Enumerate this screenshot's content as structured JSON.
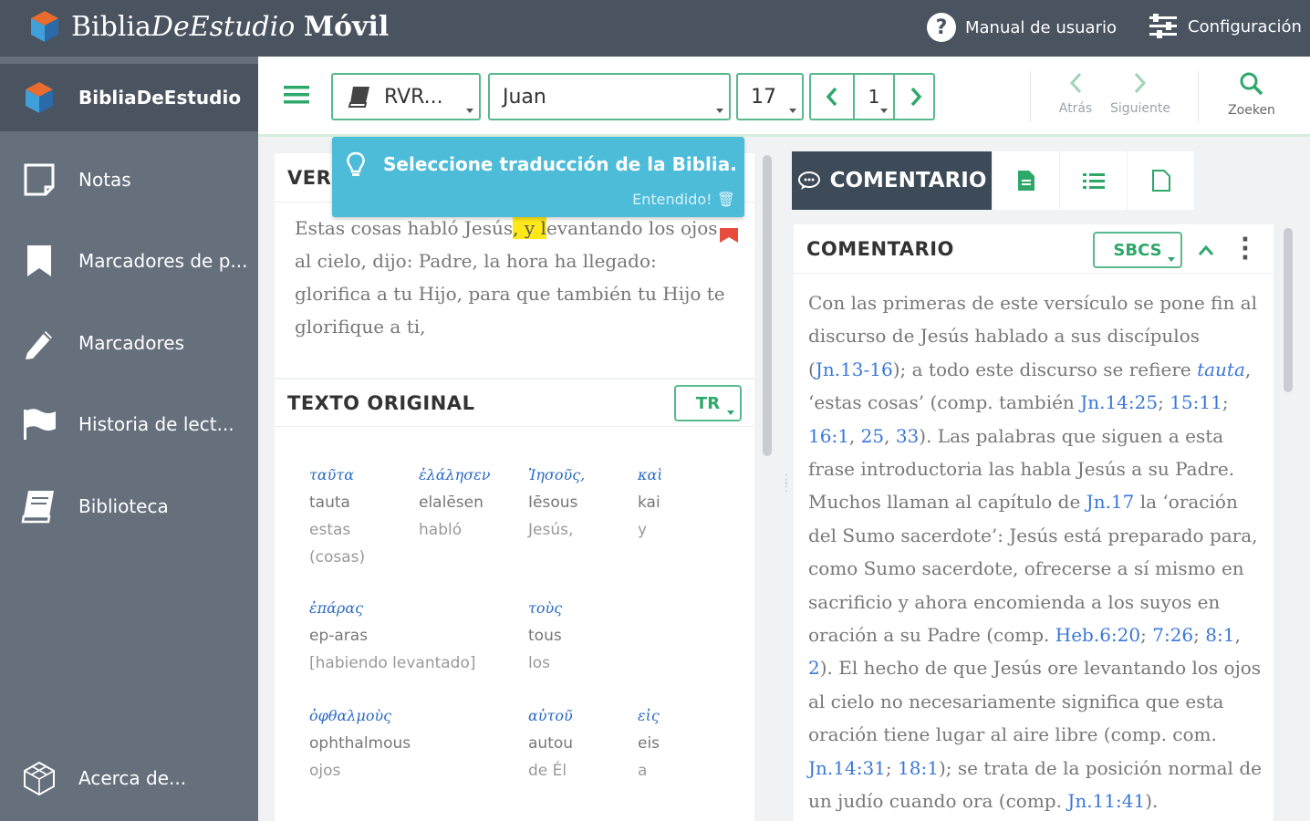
{
  "app": {
    "brand_a": "Biblia",
    "brand_b": "DeEstudio",
    "brand_c": "Móvil"
  },
  "header": {
    "help_label": "Manual de usuario",
    "settings_label": "Configuración"
  },
  "sidebar": {
    "items": [
      {
        "label": "BibliaDeEstudio",
        "icon": "cube-logo-icon",
        "active": true
      },
      {
        "label": "Notas",
        "icon": "note-icon"
      },
      {
        "label": "Marcadores de p...",
        "icon": "bookmark-icon"
      },
      {
        "label": "Marcadores",
        "icon": "pencil-icon"
      },
      {
        "label": "Historia de lect...",
        "icon": "flag-icon"
      },
      {
        "label": "Biblioteca",
        "icon": "books-icon"
      },
      {
        "label": "Acerca de...",
        "icon": "cube-outline-icon"
      }
    ]
  },
  "toolbar": {
    "translation": "RVR...",
    "book": "Juan",
    "chapter": "17",
    "verse": "1",
    "back_label": "Atrás",
    "next_label": "Siguiente",
    "search_label": "Zoeken"
  },
  "tooltip": {
    "message": "Seleccione traducción de la Biblia.",
    "dismiss": "Entendido!"
  },
  "verse_panel": {
    "title": "VER",
    "text_before": "Estas cosas habló Jesús",
    "text_highlight": ", y l",
    "text_after": "evantando los ojos al cielo, dijo: Padre, la hora ha llegado: glorifica a tu Hijo, para que también tu Hijo te glorifique a ti,"
  },
  "original_panel": {
    "title": "TEXTO ORIGINAL",
    "version": "TR",
    "words": [
      {
        "greek": "ταῦτα",
        "translit": "tauta",
        "spanish": "estas (cosas)"
      },
      {
        "greek": "ἐλάλησεν",
        "translit": "elalēsen",
        "spanish": "habló"
      },
      {
        "greek": "Ἰησοῦς,",
        "translit": "Iēsous",
        "spanish": "Jesús,"
      },
      {
        "greek": "καὶ",
        "translit": "kai",
        "spanish": "y"
      },
      {
        "greek": "ἐπάρας",
        "translit": "ep-aras",
        "spanish": "[habiendo levantado]"
      },
      {
        "greek": "τοὺς",
        "translit": "tous",
        "spanish": "los"
      },
      {
        "greek": "ὀφθαλμοὺς",
        "translit": "ophthalmous",
        "spanish": "ojos"
      },
      {
        "greek": "αὐτοῦ",
        "translit": "autou",
        "spanish": "de Él"
      },
      {
        "greek": "εἰς",
        "translit": "eis",
        "spanish": "a"
      }
    ]
  },
  "commentary": {
    "tab_label": "COMENTARIO",
    "title": "COMENTARIO",
    "source": "SBCS",
    "segments": [
      {
        "t": "Con las primeras de este versículo se pone fin al discurso de Jesús hablado a sus discípulos ("
      },
      {
        "t": "Jn.13-16",
        "link": true
      },
      {
        "t": "); a todo este discurso se refiere "
      },
      {
        "t": "tauta",
        "link": true,
        "italic": true
      },
      {
        "t": ", ‘estas cosas’ (comp. también "
      },
      {
        "t": "Jn.14:25",
        "link": true
      },
      {
        "t": "; "
      },
      {
        "t": "15:11",
        "link": true
      },
      {
        "t": "; "
      },
      {
        "t": "16:1",
        "link": true
      },
      {
        "t": ", "
      },
      {
        "t": "25",
        "link": true
      },
      {
        "t": ", "
      },
      {
        "t": "33",
        "link": true
      },
      {
        "t": "). Las palabras que siguen a esta frase introductoria las habla Jesús a su Padre. Muchos llaman al capítulo de "
      },
      {
        "t": "Jn.17",
        "link": true
      },
      {
        "t": " la ‘oración del Sumo sacerdote’: Jesús está preparado para, como Sumo sacerdote, ofrecerse a sí mismo en sacrificio y ahora encomienda a los suyos en oración a su Padre (comp. "
      },
      {
        "t": "Heb.6:20",
        "link": true
      },
      {
        "t": "; "
      },
      {
        "t": "7:26",
        "link": true
      },
      {
        "t": "; "
      },
      {
        "t": "8:1",
        "link": true
      },
      {
        "t": ", "
      },
      {
        "t": "2",
        "link": true
      },
      {
        "t": "). El hecho de que Jesús ore levantando los ojos al cielo no necesariamente significa que esta oración tiene lugar al aire libre (comp. com. "
      },
      {
        "t": "Jn.14:31",
        "link": true
      },
      {
        "t": "; "
      },
      {
        "t": "18:1",
        "link": true
      },
      {
        "t": "); se trata de la posición normal de un judío cuando ora (comp. "
      },
      {
        "t": "Jn.11:41",
        "link": true
      },
      {
        "t": ")."
      }
    ]
  },
  "colors": {
    "topbar": "#4a5360",
    "sidebar": "#66707d",
    "accent": "#2ea86a",
    "tooltip": "#4dbcd9",
    "link": "#3a78d8",
    "highlight": "#ffe818"
  }
}
